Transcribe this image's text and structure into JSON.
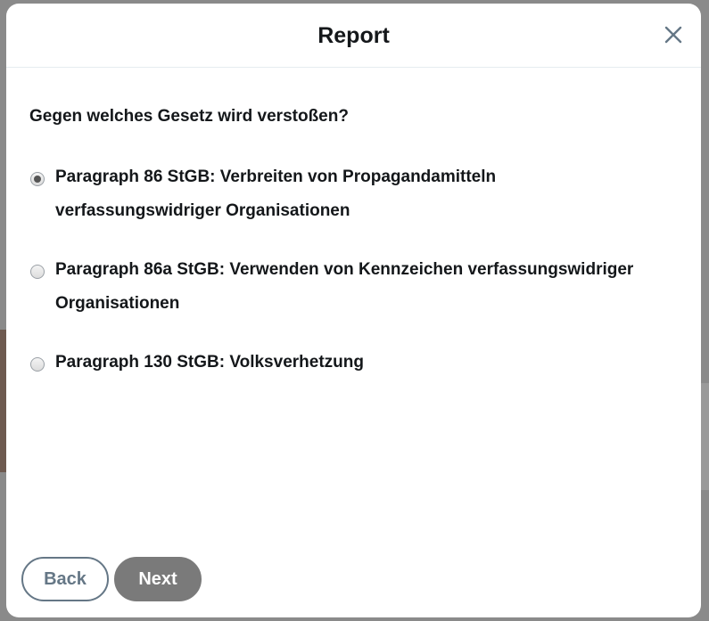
{
  "dialog": {
    "title": "Report",
    "question": "Gegen welches Gesetz wird verstoßen?",
    "options": [
      {
        "line1": "Paragraph 86 StGB: Verbreiten von Propagandamitteln",
        "line2": "verfassungswidriger Organisationen",
        "checked": true
      },
      {
        "line1": "Paragraph 86a StGB: Verwenden von Kennzeichen verfassungswidriger",
        "line2": "Organisationen",
        "checked": false
      },
      {
        "line1": "Paragraph 130 StGB: Volksverhetzung",
        "line2": "",
        "checked": false
      }
    ],
    "back_label": "Back",
    "next_label": "Next"
  },
  "icons": {
    "close": "close-icon",
    "radio": "radio-icon"
  },
  "colors": {
    "text": "#14171a",
    "secondary": "#657786",
    "next_button": "#7a7a7a",
    "divider": "#e6ecf0"
  }
}
